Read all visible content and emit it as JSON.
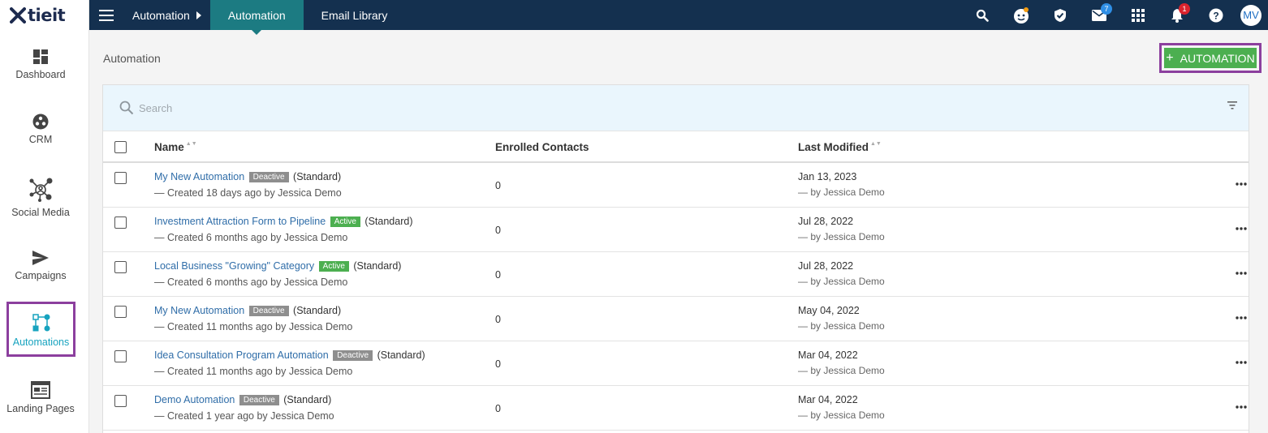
{
  "brand": {
    "logo_text": "tieit"
  },
  "sidebar": {
    "items": [
      {
        "label": "Dashboard",
        "icon": "dashboard-icon"
      },
      {
        "label": "CRM",
        "icon": "crm-icon"
      },
      {
        "label": "Social Media",
        "icon": "social-media-icon"
      },
      {
        "label": "Campaigns",
        "icon": "send-icon"
      },
      {
        "label": "Automations",
        "icon": "automations-icon",
        "active": true
      },
      {
        "label": "Landing Pages",
        "icon": "landing-pages-icon"
      }
    ]
  },
  "topbar": {
    "breadcrumb_root": "Automation",
    "active_tab": "Automation",
    "second_tab": "Email Library",
    "mail_badge": "7",
    "notifications_badge": "1",
    "avatar_initials": "MV"
  },
  "page": {
    "title": "Automation",
    "add_button_label": "AUTOMATION",
    "search_placeholder": "Search"
  },
  "table": {
    "columns": {
      "name": "Name",
      "enrolled": "Enrolled Contacts",
      "modified": "Last Modified"
    },
    "rows": [
      {
        "name": "My New Automation",
        "status": "Deactive",
        "type": "(Standard)",
        "created": "— Created 18 days ago by Jessica Demo",
        "enrolled": "0",
        "modified_date": "Jan 13, 2023",
        "modified_by": "— by Jessica Demo"
      },
      {
        "name": "Investment Attraction Form to Pipeline",
        "status": "Active",
        "type": "(Standard)",
        "created": "— Created 6 months ago by Jessica Demo",
        "enrolled": "0",
        "modified_date": "Jul 28, 2022",
        "modified_by": "— by Jessica Demo"
      },
      {
        "name": "Local Business \"Growing\" Category",
        "status": "Active",
        "type": "(Standard)",
        "created": "— Created 6 months ago by Jessica Demo",
        "enrolled": "0",
        "modified_date": "Jul 28, 2022",
        "modified_by": "— by Jessica Demo"
      },
      {
        "name": "My New Automation",
        "status": "Deactive",
        "type": "(Standard)",
        "created": "— Created 11 months ago by Jessica Demo",
        "enrolled": "0",
        "modified_date": "May 04, 2022",
        "modified_by": "— by Jessica Demo"
      },
      {
        "name": "Idea Consultation Program Automation",
        "status": "Deactive",
        "type": "(Standard)",
        "created": "— Created 11 months ago by Jessica Demo",
        "enrolled": "0",
        "modified_date": "Mar 04, 2022",
        "modified_by": "— by Jessica Demo"
      },
      {
        "name": "Demo Automation",
        "status": "Deactive",
        "type": "(Standard)",
        "created": "— Created 1 year ago by Jessica Demo",
        "enrolled": "0",
        "modified_date": "Mar 04, 2022",
        "modified_by": "— by Jessica Demo"
      }
    ]
  },
  "colors": {
    "topbar": "#14304f",
    "active_tab": "#1c7b82",
    "link": "#2f6da8",
    "active_status": "#4caf50",
    "deactive_status": "#8e8e8e",
    "highlight_outline": "#8c3f9e"
  }
}
